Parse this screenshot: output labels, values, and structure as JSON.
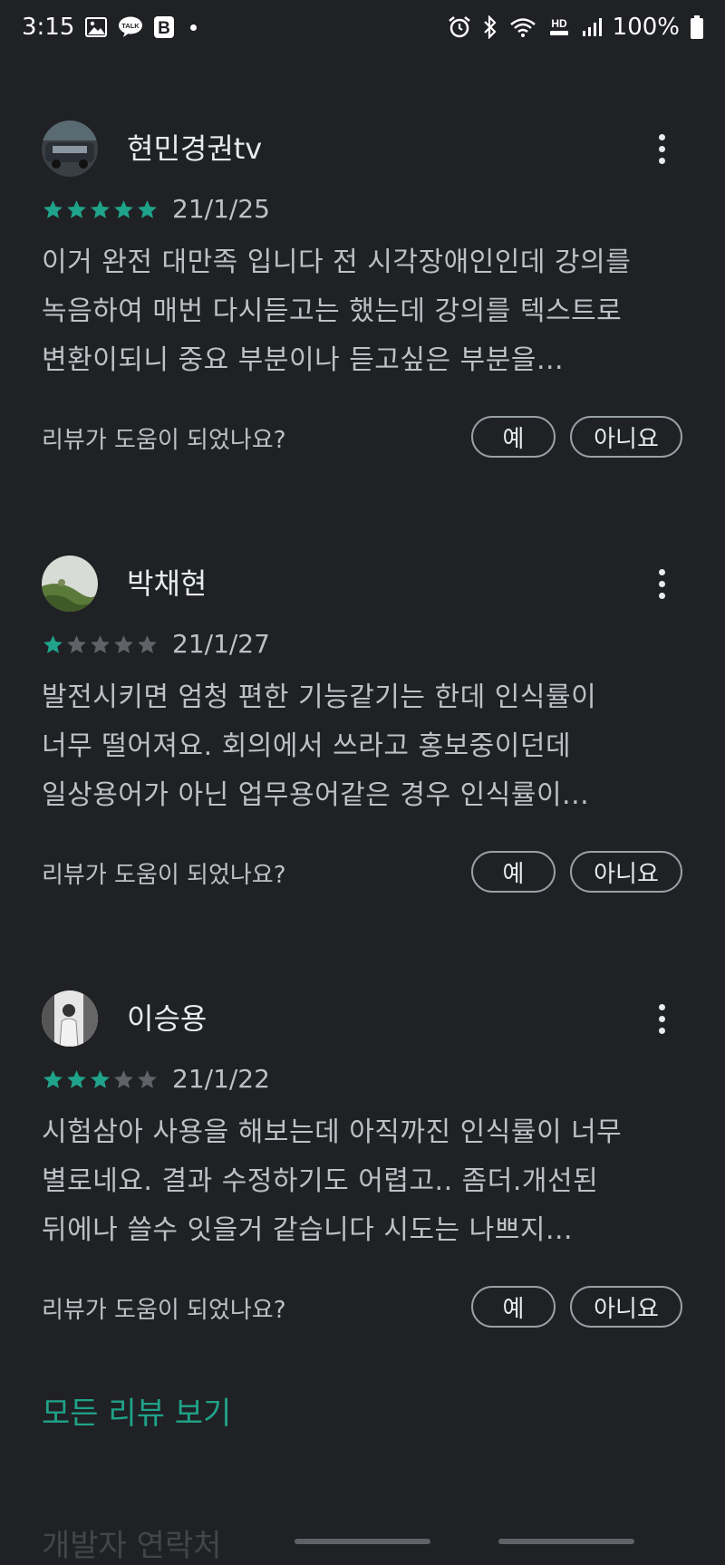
{
  "status_bar": {
    "time": "3:15",
    "battery": "100%",
    "left_icons": [
      "gallery-icon",
      "kakaotalk-icon",
      "b-app-icon",
      "notification-dot-icon"
    ],
    "right_icons": [
      "alarm-icon",
      "bluetooth-icon",
      "wifi-icon",
      "hd-voice-icon",
      "signal-icon",
      "battery-icon"
    ],
    "talk_badge": "TALK",
    "b_badge": "B",
    "hd_label": "HD"
  },
  "colors": {
    "background": "#202124",
    "star_filled": "#1fa38a",
    "star_empty": "#5f6368",
    "link": "#1fa38a"
  },
  "reviews": [
    {
      "author": "현민경권tv",
      "rating": 5,
      "max_rating": 5,
      "date": "21/1/25",
      "body_lines": [
        "이거 완전 대만족 입니다 전 시각장애인인데 강의를",
        "녹음하여 매번 다시듣고는 했는데 강의를 텍스트로",
        "변환이되니 중요 부분이나 듣고싶은 부분을..."
      ],
      "helpful_question": "리뷰가 도움이 되었나요?",
      "yes_label": "예",
      "no_label": "아니요"
    },
    {
      "author": "박채현",
      "rating": 1,
      "max_rating": 5,
      "date": "21/1/27",
      "body_lines": [
        "발전시키면 엄청 편한 기능같기는 한데 인식률이",
        "너무 떨어져요. 회의에서 쓰라고 홍보중이던데",
        "일상용어가 아닌 업무용어같은 경우 인식률이..."
      ],
      "helpful_question": "리뷰가 도움이 되었나요?",
      "yes_label": "예",
      "no_label": "아니요"
    },
    {
      "author": "이승용",
      "rating": 3,
      "max_rating": 5,
      "date": "21/1/22",
      "body_lines": [
        "시험삼아 사용을 해보는데 아직까진 인식률이 너무",
        "별로네요. 결과 수정하기도 어렵고.. 좀더.개선된",
        "뒤에나 쓸수 잇을거 같습니다 시도는 나쁘지..."
      ],
      "helpful_question": "리뷰가 도움이 되었나요?",
      "yes_label": "예",
      "no_label": "아니요"
    }
  ],
  "see_all_reviews": "모든 리뷰 보기",
  "peek_section_title": "개발자 연락처"
}
